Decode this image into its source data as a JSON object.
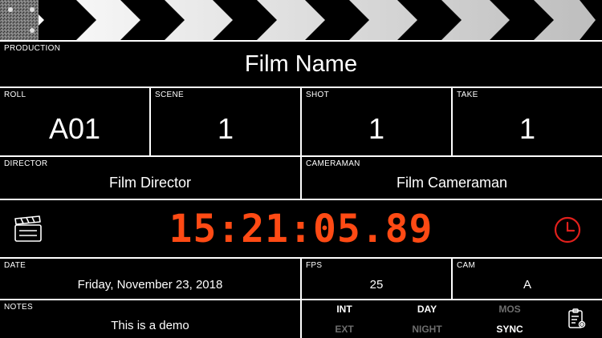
{
  "production": {
    "label": "PRODUCTION",
    "value": "Film Name"
  },
  "roll": {
    "label": "ROLL",
    "value": "A01"
  },
  "scene": {
    "label": "SCENE",
    "value": "1"
  },
  "shot": {
    "label": "SHOT",
    "value": "1"
  },
  "take": {
    "label": "TAKE",
    "value": "1"
  },
  "director": {
    "label": "DIRECTOR",
    "value": "Film Director"
  },
  "cameraman": {
    "label": "CAMERAMAN",
    "value": "Film Cameraman"
  },
  "timecode": {
    "value": "15:21:05.89",
    "color": "#ff4a14"
  },
  "date": {
    "label": "DATE",
    "value": "Friday, November 23, 2018"
  },
  "fps": {
    "label": "FPS",
    "value": "25"
  },
  "cam": {
    "label": "CAM",
    "value": "A"
  },
  "notes": {
    "label": "NOTES",
    "value": "This is a demo"
  },
  "toggles": {
    "int": {
      "label": "INT",
      "active": true
    },
    "day": {
      "label": "DAY",
      "active": true
    },
    "mos": {
      "label": "MOS",
      "active": false
    },
    "ext": {
      "label": "EXT",
      "active": false
    },
    "night": {
      "label": "NIGHT",
      "active": false
    },
    "sync": {
      "label": "SYNC",
      "active": true
    }
  },
  "icons": {
    "clapperboard": "clapperboard-icon",
    "clock": "clock-icon",
    "settings": "clipboard-settings-icon"
  },
  "colors": {
    "accent": "#ff4a14",
    "clock": "#e0201c",
    "inactive": "#6e6e6e"
  }
}
